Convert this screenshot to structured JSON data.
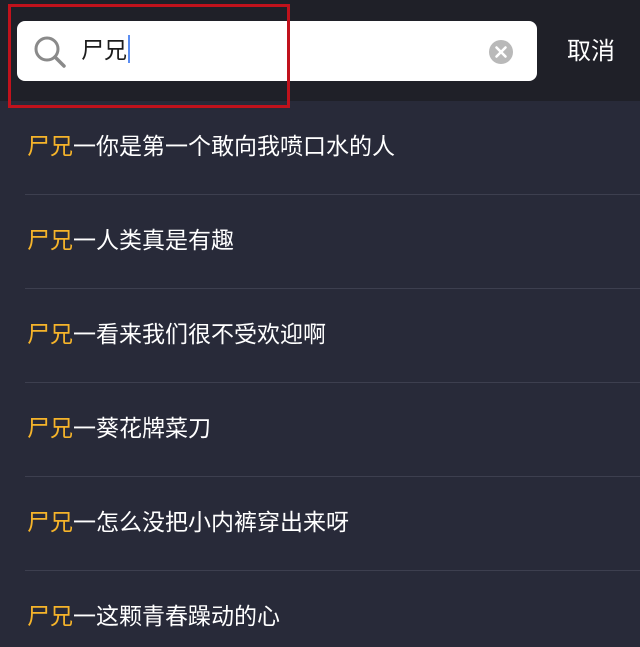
{
  "search": {
    "value": "尸兄",
    "cancel_label": "取消",
    "icon": "search-icon",
    "clear_icon": "clear-icon"
  },
  "colors": {
    "keyword_highlight": "#f6b42a",
    "background": "#282a39",
    "header": "#1f2028",
    "annotation_box": "#c0121c"
  },
  "results": [
    {
      "keyword": "尸兄",
      "rest": "一你是第一个敢向我喷口水的人"
    },
    {
      "keyword": "尸兄",
      "rest": "一人类真是有趣"
    },
    {
      "keyword": "尸兄",
      "rest": "一看来我们很不受欢迎啊"
    },
    {
      "keyword": "尸兄",
      "rest": "一葵花牌菜刀"
    },
    {
      "keyword": "尸兄",
      "rest": "一怎么没把小内裤穿出来呀"
    },
    {
      "keyword": "尸兄",
      "rest": "一这颗青春躁动的心"
    }
  ]
}
